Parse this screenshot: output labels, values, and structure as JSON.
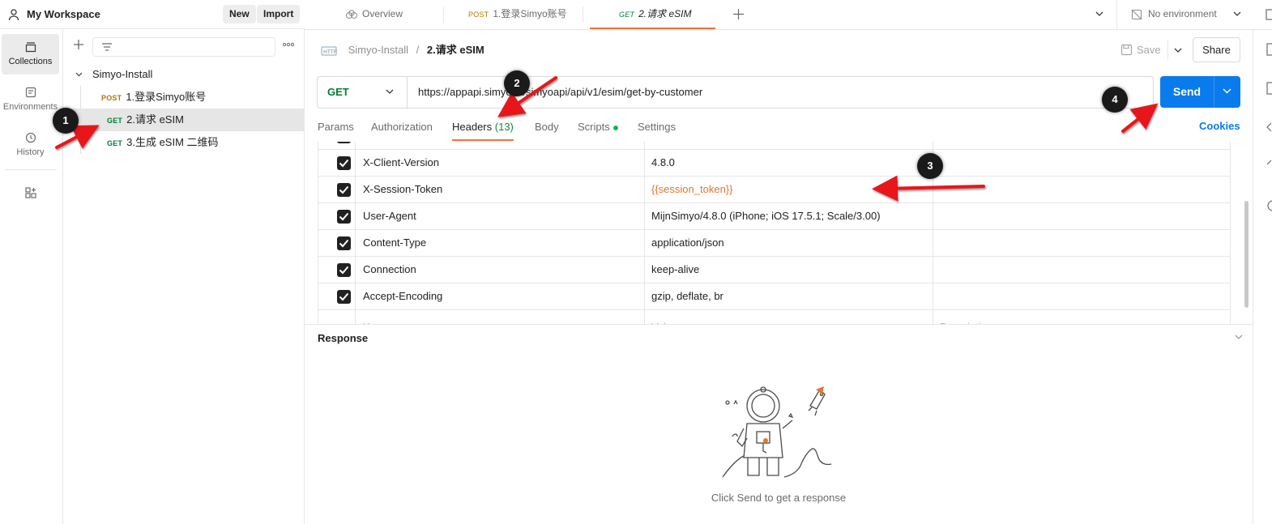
{
  "workspace": {
    "title": "My Workspace",
    "new_label": "New",
    "import_label": "Import"
  },
  "rail": {
    "items": [
      {
        "label": "Collections",
        "icon": "collections-icon",
        "active": true
      },
      {
        "label": "Environments",
        "icon": "environments-icon",
        "active": false
      },
      {
        "label": "History",
        "icon": "history-icon",
        "active": false
      },
      {
        "label": "",
        "icon": "configure-workbench-icon",
        "active": false
      }
    ]
  },
  "sidebar": {
    "collection_name": "Simyo-Install",
    "requests": [
      {
        "method": "POST",
        "name": "1.登录Simyo账号",
        "selected": false
      },
      {
        "method": "GET",
        "name": "2.请求 eSIM",
        "selected": true
      },
      {
        "method": "GET",
        "name": "3.生成 eSIM 二维码",
        "selected": false
      }
    ]
  },
  "tabs": [
    {
      "method": "",
      "label": "Overview",
      "active": false
    },
    {
      "method": "POST",
      "label": "1.登录Simyo账号",
      "active": false
    },
    {
      "method": "GET",
      "label": "2.请求 eSIM",
      "active": true
    }
  ],
  "environment": {
    "label": "No environment"
  },
  "breadcrumb": {
    "parent": "Simyo-Install",
    "separator": "/",
    "current": "2.请求 eSIM"
  },
  "actions": {
    "save_label": "Save",
    "share_label": "Share",
    "send_label": "Send",
    "cookies_label": "Cookies"
  },
  "request": {
    "method": "GET",
    "url": "https://appapi.simyo.nl/simyoapi/api/v1/esim/get-by-customer"
  },
  "request_tabs": [
    {
      "label": "Params",
      "count": "",
      "active": false
    },
    {
      "label": "Authorization",
      "count": "",
      "active": false
    },
    {
      "label": "Headers",
      "count": "(13)",
      "active": true
    },
    {
      "label": "Body",
      "count": "",
      "active": false
    },
    {
      "label": "Scripts",
      "count": "",
      "active": false
    },
    {
      "label": "Settings",
      "count": "",
      "active": false
    }
  ],
  "headers": {
    "rows": [
      {
        "key": "X-Client-Version",
        "value": "4.8.0",
        "checked": true,
        "is_variable": false
      },
      {
        "key": "X-Session-Token",
        "value": "{{session_token}}",
        "checked": true,
        "is_variable": true
      },
      {
        "key": "User-Agent",
        "value": "MijnSimyo/4.8.0 (iPhone; iOS 17.5.1; Scale/3.00)",
        "checked": true,
        "is_variable": false
      },
      {
        "key": "Content-Type",
        "value": "application/json",
        "checked": true,
        "is_variable": false
      },
      {
        "key": "Connection",
        "value": "keep-alive",
        "checked": true,
        "is_variable": false
      },
      {
        "key": "Accept-Encoding",
        "value": "gzip, deflate, br",
        "checked": true,
        "is_variable": false
      }
    ],
    "placeholder": {
      "key": "Key",
      "value": "Value",
      "description": "Description"
    }
  },
  "response": {
    "title": "Response",
    "hint": "Click Send to get a response"
  },
  "annotations": {
    "badges": [
      "1",
      "2",
      "3",
      "4"
    ],
    "arrow_color": "#e8161b"
  },
  "colors": {
    "accent": "#ff6c37",
    "send": "#097bed",
    "get": "#007f31",
    "post": "#ad7a03",
    "variable": "#e6752f"
  }
}
